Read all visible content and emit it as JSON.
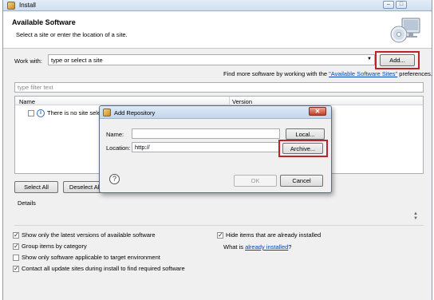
{
  "window": {
    "title": "Install",
    "min_glyph": "–",
    "max_glyph": "□"
  },
  "header": {
    "title": "Available Software",
    "subtitle": "Select a site or enter the location of a site."
  },
  "work_with": {
    "label": "Work with:",
    "value": "type or select a site",
    "add_label": "Add..."
  },
  "find_more": {
    "prefix": "Find more software by working with the ",
    "link": "\"Available Software Sites\"",
    "suffix": " preferences."
  },
  "filter": {
    "placeholder": "type filter text"
  },
  "tree": {
    "columns": [
      "Name",
      "Version"
    ],
    "message": "There is no site selected."
  },
  "buttons": {
    "select_all": "Select All",
    "deselect_all": "Deselect All"
  },
  "details": {
    "label": "Details"
  },
  "options": {
    "latest_versions": {
      "label": "Show only the latest versions of available software",
      "checked": true
    },
    "group_by_category": {
      "label": "Group items by category",
      "checked": true
    },
    "target_env": {
      "label": "Show only software applicable to target environment",
      "checked": false
    },
    "contact_sites": {
      "label": "Contact all update sites during install to find required software",
      "checked": true
    },
    "hide_installed": {
      "label": "Hide items that are already installed",
      "checked": true
    },
    "what_is": {
      "prefix": "What is ",
      "link": "already installed",
      "suffix": "?"
    }
  },
  "dialog": {
    "title": "Add Repository",
    "close_glyph": "✕",
    "name_label": "Name:",
    "name_value": "",
    "local_label": "Local...",
    "location_label": "Location:",
    "location_value": "http://",
    "archive_label": "Archive...",
    "help_glyph": "?",
    "ok_label": "OK",
    "cancel_label": "Cancel"
  },
  "colors": {
    "highlight_box": "#c0202a",
    "link": "#0645ad"
  }
}
